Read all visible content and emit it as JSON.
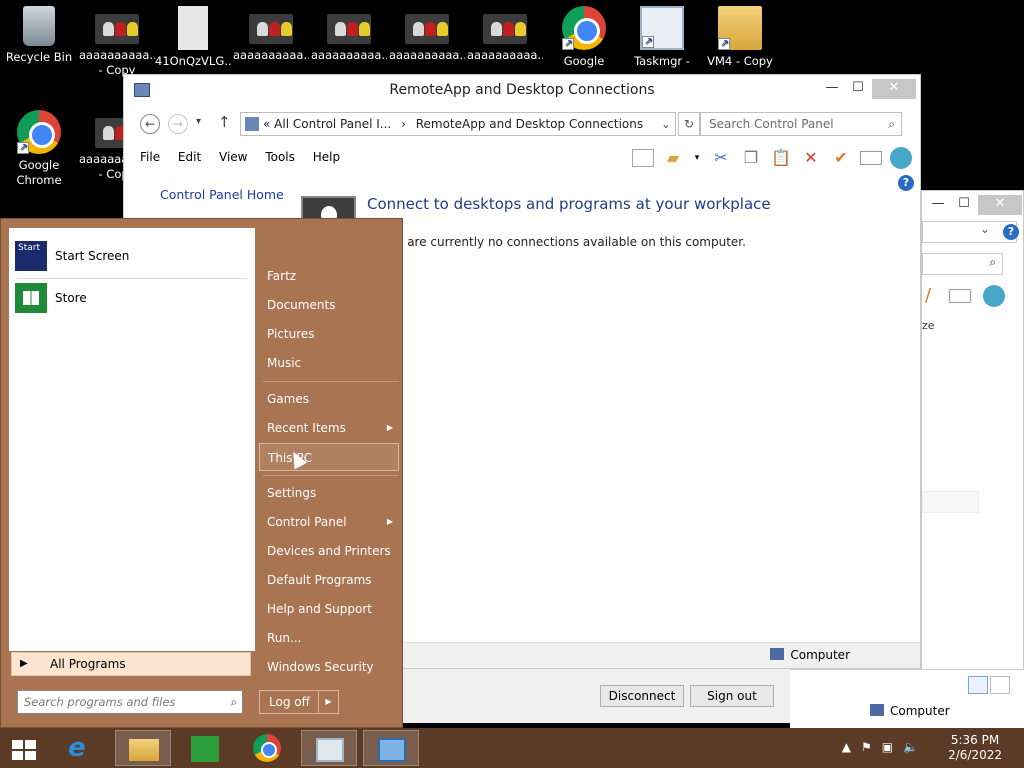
{
  "desktop": {
    "icons": [
      {
        "label": "Recycle Bin",
        "label2": ""
      },
      {
        "label": "aaaaaaaaaa...",
        "label2": "- Copy"
      },
      {
        "label": "41OnQzVLG...",
        "label2": ""
      },
      {
        "label": "aaaaaaaaaa...",
        "label2": ""
      },
      {
        "label": "aaaaaaaaaa...",
        "label2": ""
      },
      {
        "label": "aaaaaaaaaa...",
        "label2": ""
      },
      {
        "label": "aaaaaaaaaa...",
        "label2": ""
      },
      {
        "label": "Google",
        "label2": ""
      },
      {
        "label": "Taskmgr -",
        "label2": ""
      },
      {
        "label": "VM4 - Copy",
        "label2": ""
      },
      {
        "label": "Google",
        "label2": "Chrome"
      },
      {
        "label": "aaaaaaaaaa...",
        "label2": "- Copy"
      }
    ]
  },
  "control_panel": {
    "title": "RemoteApp and Desktop Connections",
    "address": {
      "path1": "All Control Panel I...",
      "sep": "›",
      "path2": "RemoteApp and Desktop Connections",
      "chevrons": "«"
    },
    "search_placeholder": "Search Control Panel",
    "menu": {
      "file": "File",
      "edit": "Edit",
      "view": "View",
      "tools": "Tools",
      "help": "Help"
    },
    "sidebar_link": "Control Panel Home",
    "heading": "Connect to desktops and programs at your workplace",
    "message_prefix": "Th",
    "message": "ere are currently no connections available on this computer.",
    "status_computer": "Computer"
  },
  "dialog": {
    "disconnect": "Disconnect",
    "sign_out": "Sign out",
    "status_computer": "Computer"
  },
  "back_window": {
    "partial_text": "ze"
  },
  "start_menu": {
    "left_items": [
      {
        "label": "Start Screen"
      },
      {
        "label": "Store"
      }
    ],
    "all_programs": "All Programs",
    "search_placeholder": "Search programs and files",
    "right_items": {
      "fartz": "Fartz",
      "documents": "Documents",
      "pictures": "Pictures",
      "music": "Music",
      "games": "Games",
      "recent_items": "Recent Items",
      "this_pc": "This PC",
      "settings": "Settings",
      "control_panel": "Control Panel",
      "devices_printers": "Devices and Printers",
      "default_programs": "Default Programs",
      "help_support": "Help and Support",
      "run": "Run...",
      "windows_security": "Windows Security"
    },
    "log_off": "Log off"
  },
  "taskbar": {
    "time": "5:36 PM",
    "date": "2/6/2022"
  },
  "colors": {
    "start_menu_bg": "#a97451",
    "taskbar_bg": "#5c3b26",
    "link_blue": "#1e3e8a"
  }
}
